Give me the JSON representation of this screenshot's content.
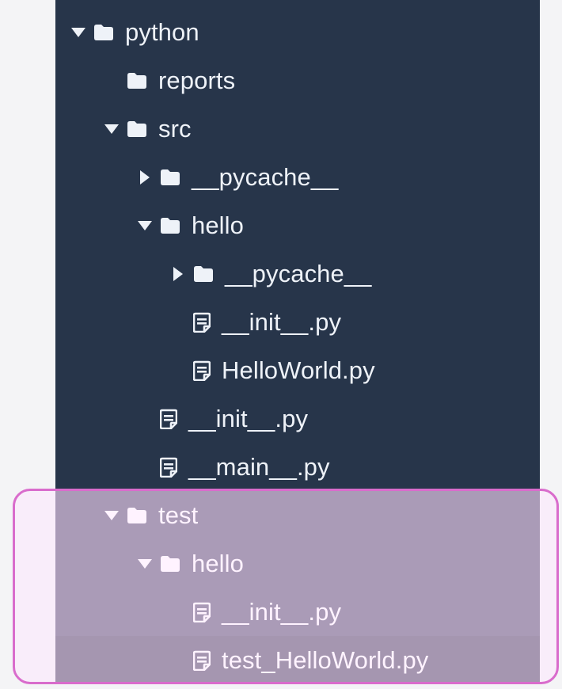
{
  "tree": {
    "items": [
      {
        "label": "python",
        "type": "folder",
        "state": "expanded"
      },
      {
        "label": "reports",
        "type": "folder",
        "state": "none"
      },
      {
        "label": "src",
        "type": "folder",
        "state": "expanded"
      },
      {
        "label": "__pycache__",
        "type": "folder",
        "state": "collapsed"
      },
      {
        "label": "hello",
        "type": "folder",
        "state": "expanded"
      },
      {
        "label": "__pycache__",
        "type": "folder",
        "state": "collapsed"
      },
      {
        "label": "__init__.py",
        "type": "file",
        "state": "none"
      },
      {
        "label": "HelloWorld.py",
        "type": "file",
        "state": "none"
      },
      {
        "label": "__init__.py",
        "type": "file",
        "state": "none"
      },
      {
        "label": "__main__.py",
        "type": "file",
        "state": "none"
      },
      {
        "label": "test",
        "type": "folder",
        "state": "expanded"
      },
      {
        "label": "hello",
        "type": "folder",
        "state": "expanded"
      },
      {
        "label": "__init__.py",
        "type": "file",
        "state": "none"
      },
      {
        "label": "test_HelloWorld.py",
        "type": "file",
        "state": "none"
      }
    ]
  },
  "colors": {
    "panel_bg": "#27354a",
    "text": "#eef2f8",
    "highlight_bg": "#645f7d",
    "selected_bg": "#5b5670",
    "outline": "#d96ccc"
  }
}
